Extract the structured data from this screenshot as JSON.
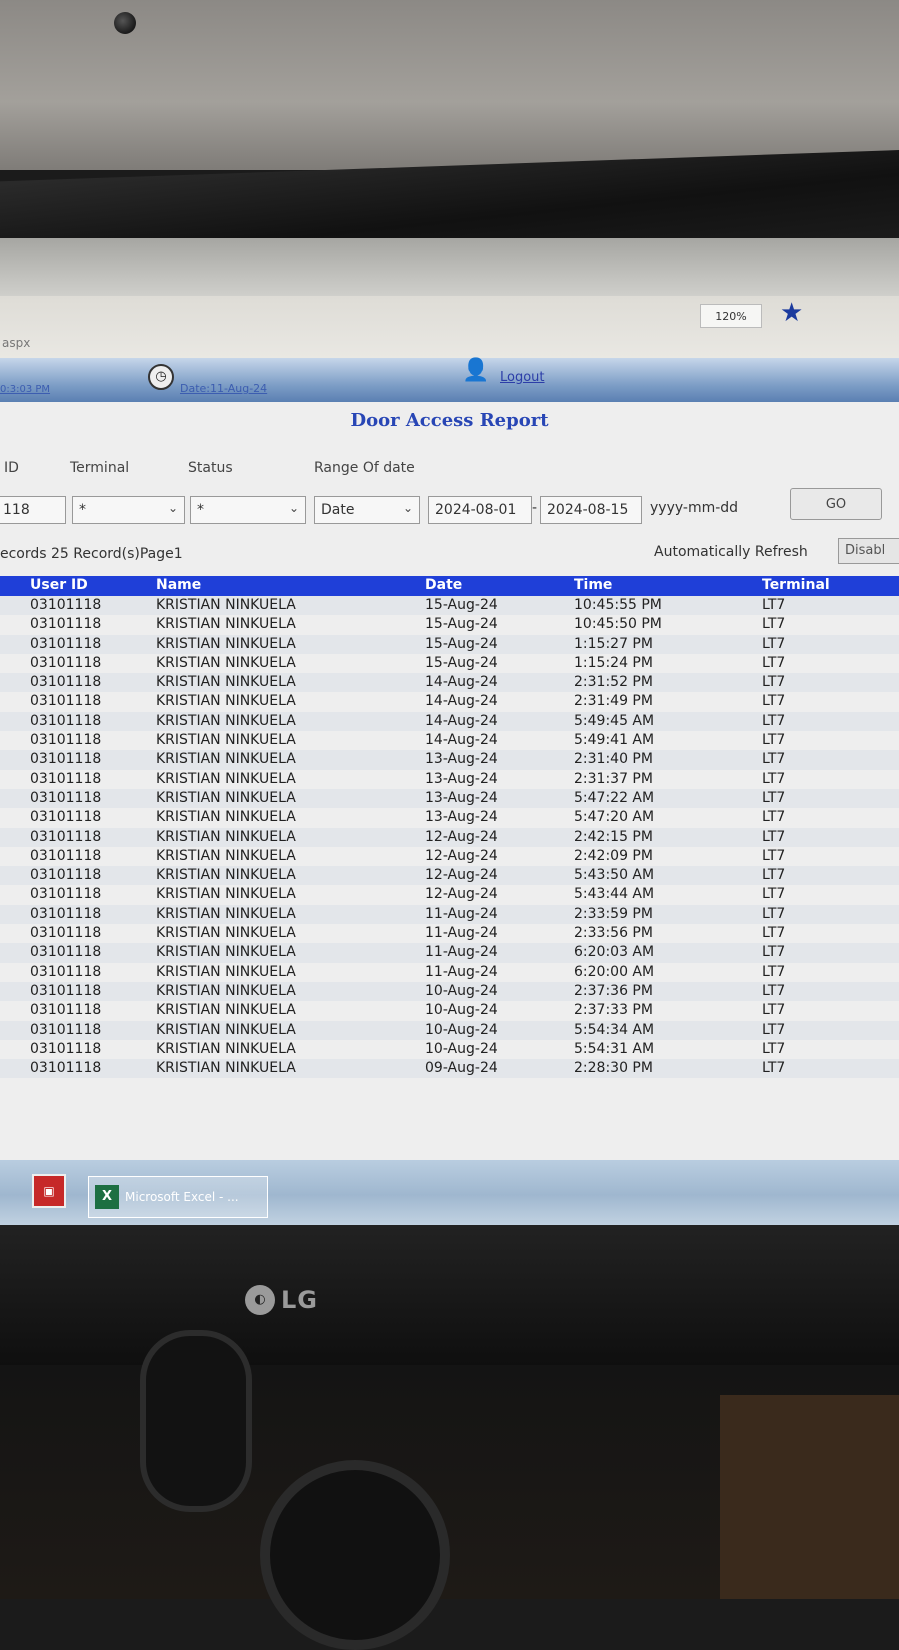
{
  "browser": {
    "address_fragment": "aspx",
    "zoom": "120%",
    "icons": {
      "favorite": "star-icon"
    }
  },
  "header": {
    "time_link": "0:3:03 PM",
    "date_link": "Date:11-Aug-24",
    "logout_label": "Logout",
    "icons": {
      "clock": "clock-icon",
      "logout": "logout-icon"
    }
  },
  "report": {
    "title": "Door Access Report"
  },
  "filters": {
    "id_label": "ID",
    "id_value": "118",
    "terminal_label": "Terminal",
    "terminal_value": "*",
    "status_label": "Status",
    "status_value": "*",
    "range_label": "Range Of date",
    "range_mode": "Date",
    "date_from": "2024-08-01",
    "date_separator": "-",
    "date_to": "2024-08-15",
    "date_format_hint": "yyyy-mm-dd",
    "go_label": "GO"
  },
  "summary": {
    "records_text": "ecords 25 Record(s)Page1",
    "auto_refresh_label": "Automatically Refresh",
    "auto_refresh_value": "Disabl"
  },
  "table": {
    "columns": [
      "User ID",
      "Name",
      "Date",
      "Time",
      "Terminal"
    ],
    "rows": [
      [
        "03101118",
        "KRISTIAN NINKUELA",
        "15-Aug-24",
        "10:45:55 PM",
        "LT7"
      ],
      [
        "03101118",
        "KRISTIAN NINKUELA",
        "15-Aug-24",
        "10:45:50 PM",
        "LT7"
      ],
      [
        "03101118",
        "KRISTIAN NINKUELA",
        "15-Aug-24",
        "1:15:27 PM",
        "LT7"
      ],
      [
        "03101118",
        "KRISTIAN NINKUELA",
        "15-Aug-24",
        "1:15:24 PM",
        "LT7"
      ],
      [
        "03101118",
        "KRISTIAN NINKUELA",
        "14-Aug-24",
        "2:31:52 PM",
        "LT7"
      ],
      [
        "03101118",
        "KRISTIAN NINKUELA",
        "14-Aug-24",
        "2:31:49 PM",
        "LT7"
      ],
      [
        "03101118",
        "KRISTIAN NINKUELA",
        "14-Aug-24",
        "5:49:45 AM",
        "LT7"
      ],
      [
        "03101118",
        "KRISTIAN NINKUELA",
        "14-Aug-24",
        "5:49:41 AM",
        "LT7"
      ],
      [
        "03101118",
        "KRISTIAN NINKUELA",
        "13-Aug-24",
        "2:31:40 PM",
        "LT7"
      ],
      [
        "03101118",
        "KRISTIAN NINKUELA",
        "13-Aug-24",
        "2:31:37 PM",
        "LT7"
      ],
      [
        "03101118",
        "KRISTIAN NINKUELA",
        "13-Aug-24",
        "5:47:22 AM",
        "LT7"
      ],
      [
        "03101118",
        "KRISTIAN NINKUELA",
        "13-Aug-24",
        "5:47:20 AM",
        "LT7"
      ],
      [
        "03101118",
        "KRISTIAN NINKUELA",
        "12-Aug-24",
        "2:42:15 PM",
        "LT7"
      ],
      [
        "03101118",
        "KRISTIAN NINKUELA",
        "12-Aug-24",
        "2:42:09 PM",
        "LT7"
      ],
      [
        "03101118",
        "KRISTIAN NINKUELA",
        "12-Aug-24",
        "5:43:50 AM",
        "LT7"
      ],
      [
        "03101118",
        "KRISTIAN NINKUELA",
        "12-Aug-24",
        "5:43:44 AM",
        "LT7"
      ],
      [
        "03101118",
        "KRISTIAN NINKUELA",
        "11-Aug-24",
        "2:33:59 PM",
        "LT7"
      ],
      [
        "03101118",
        "KRISTIAN NINKUELA",
        "11-Aug-24",
        "2:33:56 PM",
        "LT7"
      ],
      [
        "03101118",
        "KRISTIAN NINKUELA",
        "11-Aug-24",
        "6:20:03 AM",
        "LT7"
      ],
      [
        "03101118",
        "KRISTIAN NINKUELA",
        "11-Aug-24",
        "6:20:00 AM",
        "LT7"
      ],
      [
        "03101118",
        "KRISTIAN NINKUELA",
        "10-Aug-24",
        "2:37:36 PM",
        "LT7"
      ],
      [
        "03101118",
        "KRISTIAN NINKUELA",
        "10-Aug-24",
        "2:37:33 PM",
        "LT7"
      ],
      [
        "03101118",
        "KRISTIAN NINKUELA",
        "10-Aug-24",
        "5:54:34 AM",
        "LT7"
      ],
      [
        "03101118",
        "KRISTIAN NINKUELA",
        "10-Aug-24",
        "5:54:31 AM",
        "LT7"
      ],
      [
        "03101118",
        "KRISTIAN NINKUELA",
        "09-Aug-24",
        "2:28:30 PM",
        "LT7"
      ]
    ]
  },
  "taskbar": {
    "excel_label": "Microsoft Excel - ...",
    "icons": {
      "app": "pdf-app-icon",
      "excel": "excel-icon"
    }
  },
  "monitor": {
    "brand": "LG"
  },
  "colors": {
    "header_row": "#1f3fd8",
    "title": "#2846b5"
  }
}
